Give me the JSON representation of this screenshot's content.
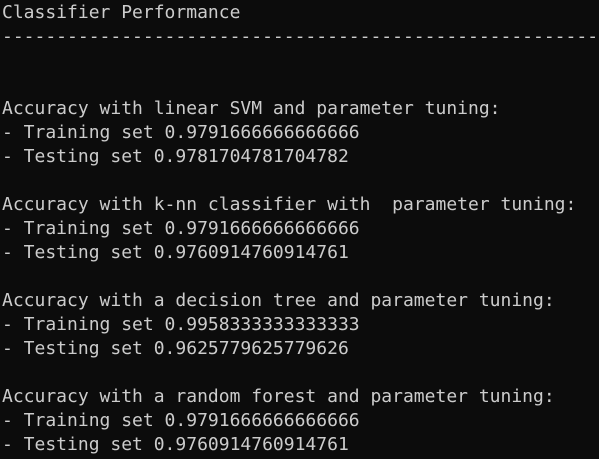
{
  "header": {
    "title": "Classifier Performance",
    "divider": "------------------------------------------------------------"
  },
  "results": [
    {
      "heading": "Accuracy with linear SVM and parameter tuning:",
      "training": "- Training set 0.9791666666666666",
      "testing": "- Testing set 0.9781704781704782"
    },
    {
      "heading": "Accuracy with k-nn classifier with  parameter tuning:",
      "training": "- Training set 0.9791666666666666",
      "testing": "- Testing set 0.9760914760914761"
    },
    {
      "heading": "Accuracy with a decision tree and parameter tuning:",
      "training": "- Training set 0.9958333333333333",
      "testing": "- Testing set 0.9625779625779626"
    },
    {
      "heading": "Accuracy with a random forest and parameter tuning:",
      "training": "- Training set 0.9791666666666666",
      "testing": "- Testing set 0.9760914760914761"
    }
  ]
}
